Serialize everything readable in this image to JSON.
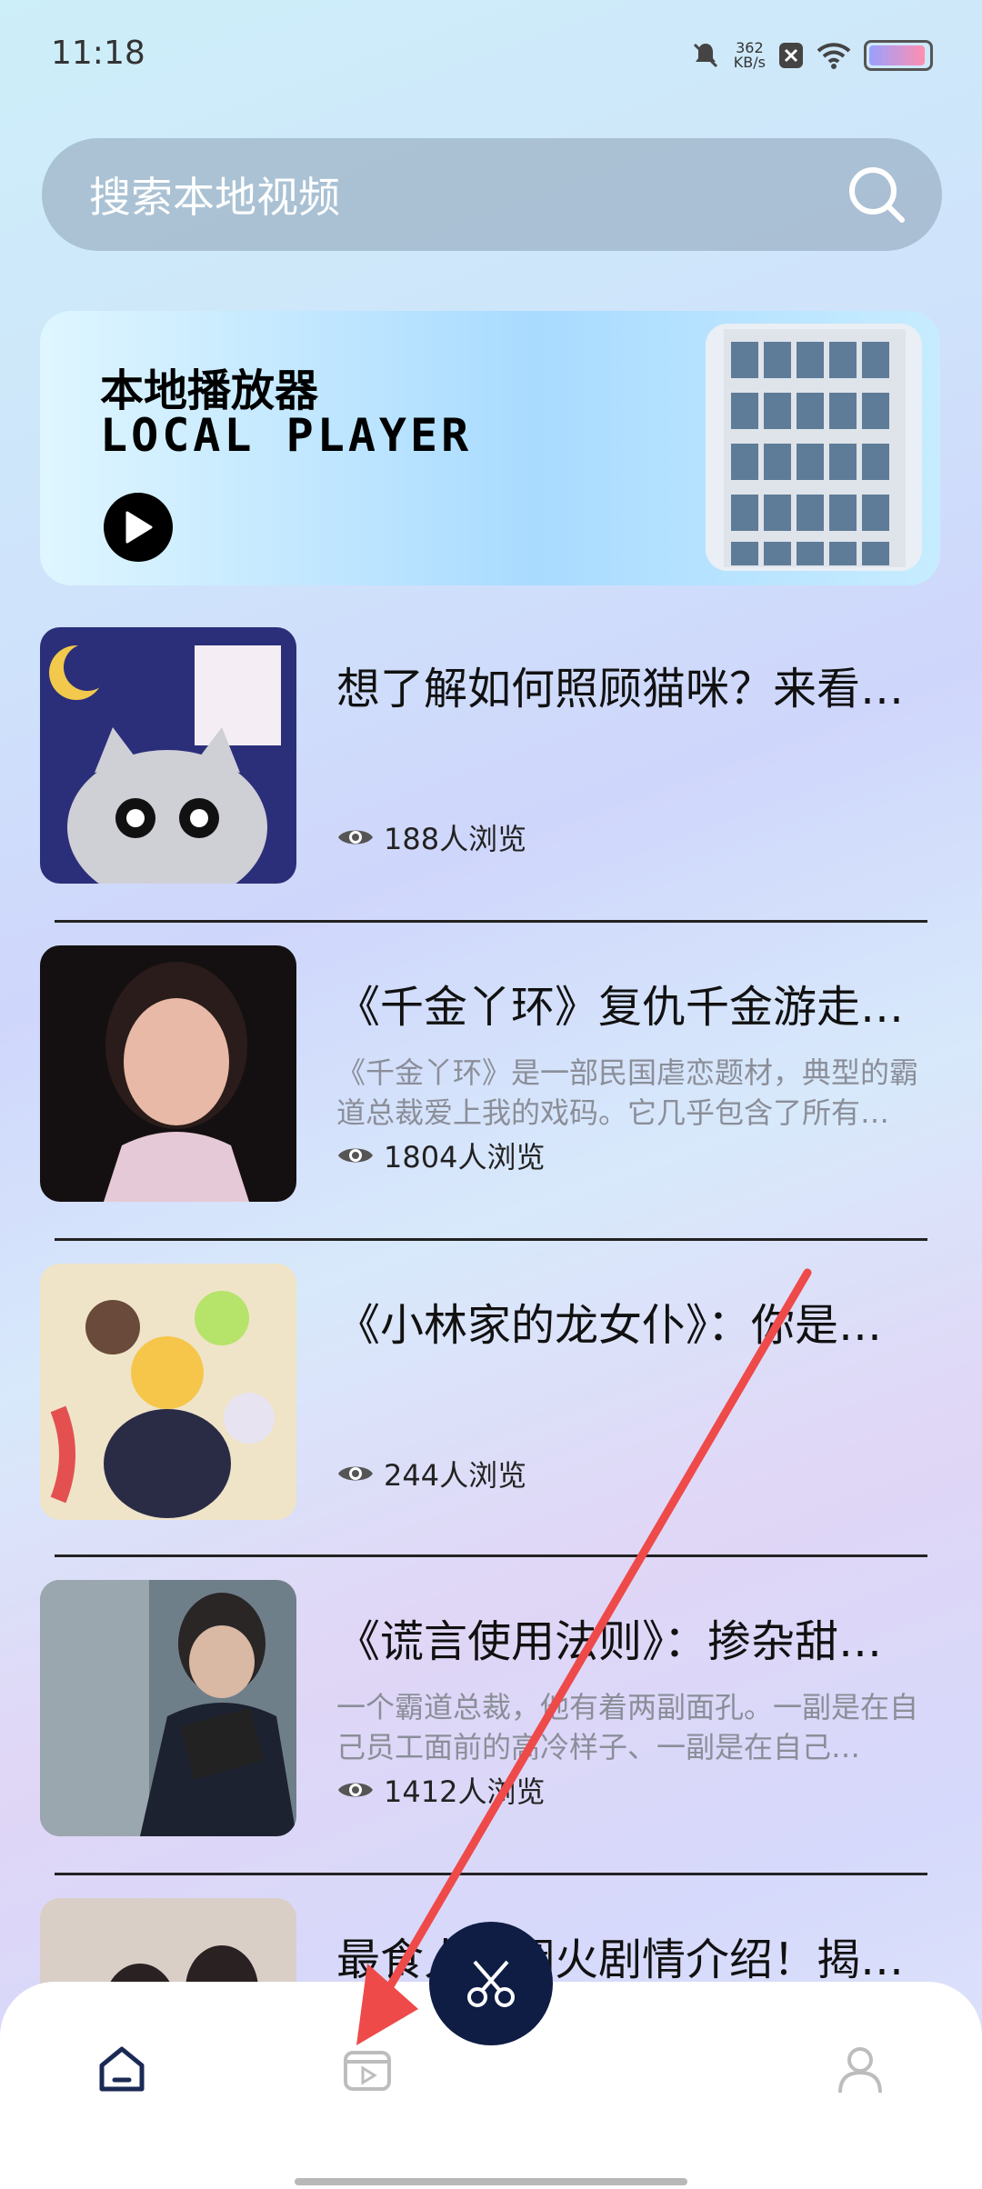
{
  "status_bar": {
    "time": "11:18",
    "net_speed_value": "362",
    "net_speed_unit": "KB/s"
  },
  "search": {
    "placeholder": "搜索本地视频"
  },
  "banner": {
    "title_cn": "本地播放器",
    "title_en": "LOCAL PLAYER"
  },
  "list": [
    {
      "title": "想了解如何照顾猫咪？来看…",
      "desc": "",
      "views": "188人浏览"
    },
    {
      "title": "《千金丫环》复仇千金游走…",
      "desc": "《千金丫环》是一部民国虐恋题材，典型的霸道总裁爱上我的戏码。它几乎包含了所有…",
      "views": "1804人浏览"
    },
    {
      "title": "《小林家的龙女仆》：你是…",
      "desc": "",
      "views": "244人浏览"
    },
    {
      "title": "《谎言使用法则》：掺杂甜…",
      "desc": "一个霸道总裁，他有着两副面孔。一副是在自己员工面前的高冷样子、一副是在自己…",
      "views": "1412人浏览"
    },
    {
      "title": "最食人间烟火剧情介绍！揭…",
      "desc": "",
      "views": ""
    }
  ],
  "nav": {
    "items": [
      "home-icon",
      "video-icon",
      "user-icon"
    ],
    "fab_icon": "scissors-icon"
  },
  "colors": {
    "fab": "#0f1d44",
    "arrow": "#ee4a4a",
    "nav_active": "#1b2a55",
    "nav_inactive": "#bdbdbd"
  }
}
